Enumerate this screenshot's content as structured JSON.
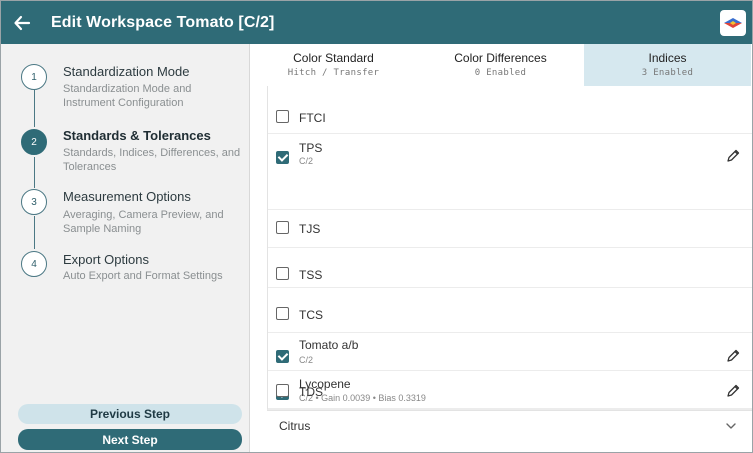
{
  "header": {
    "title": "Edit Workspace Tomato [C/2]",
    "back_icon": "arrow-left-icon",
    "logo_icon": "brand-logo-icon"
  },
  "steps": [
    {
      "number": "1",
      "title": "Standardization Mode",
      "subtitle": "Standardization Mode and Instrument Configuration",
      "active": false
    },
    {
      "number": "2",
      "title": "Standards & Tolerances",
      "subtitle": "Standards, Indices, Differences, and Tolerances",
      "active": true
    },
    {
      "number": "3",
      "title": "Measurement Options",
      "subtitle": "Averaging, Camera Preview, and Sample Naming",
      "active": false
    },
    {
      "number": "4",
      "title": "Export Options",
      "subtitle": "Auto Export and Format Settings",
      "active": false
    }
  ],
  "buttons": {
    "previous": "Previous Step",
    "next": "Next Step"
  },
  "tabs": [
    {
      "label": "Color Standard",
      "sub": "Hitch / Transfer",
      "active": false
    },
    {
      "label": "Color Differences",
      "sub": "0 Enabled",
      "active": false
    },
    {
      "label": "Indices",
      "sub": "3 Enabled",
      "active": true
    }
  ],
  "indices": [
    {
      "label": "FTCI",
      "sub": "",
      "checked": false,
      "editable": false
    },
    {
      "label": "TPS",
      "sub": "C/2",
      "checked": true,
      "editable": true
    },
    {
      "label": "TJS",
      "sub": "",
      "checked": false,
      "editable": false
    },
    {
      "label": "TSS",
      "sub": "",
      "checked": false,
      "editable": false
    },
    {
      "label": "TCS",
      "sub": "",
      "checked": false,
      "editable": false
    },
    {
      "label": "Tomato a/b",
      "sub": "C/2",
      "checked": true,
      "editable": true
    },
    {
      "label": "Lycopene",
      "sub": "C/2 • Gain 0.0039 • Bias 0.3319",
      "checked": true,
      "editable": true
    },
    {
      "label": "TDS",
      "sub": "",
      "checked": false,
      "editable": false
    }
  ],
  "group": {
    "label": "Citrus",
    "icon": "chevron-down-icon"
  },
  "colors": {
    "primary": "#2f6b77",
    "active_tab": "#d6e8ef",
    "prev_button": "#cfe3ea",
    "sidebar_bg": "#f1f1f1"
  }
}
